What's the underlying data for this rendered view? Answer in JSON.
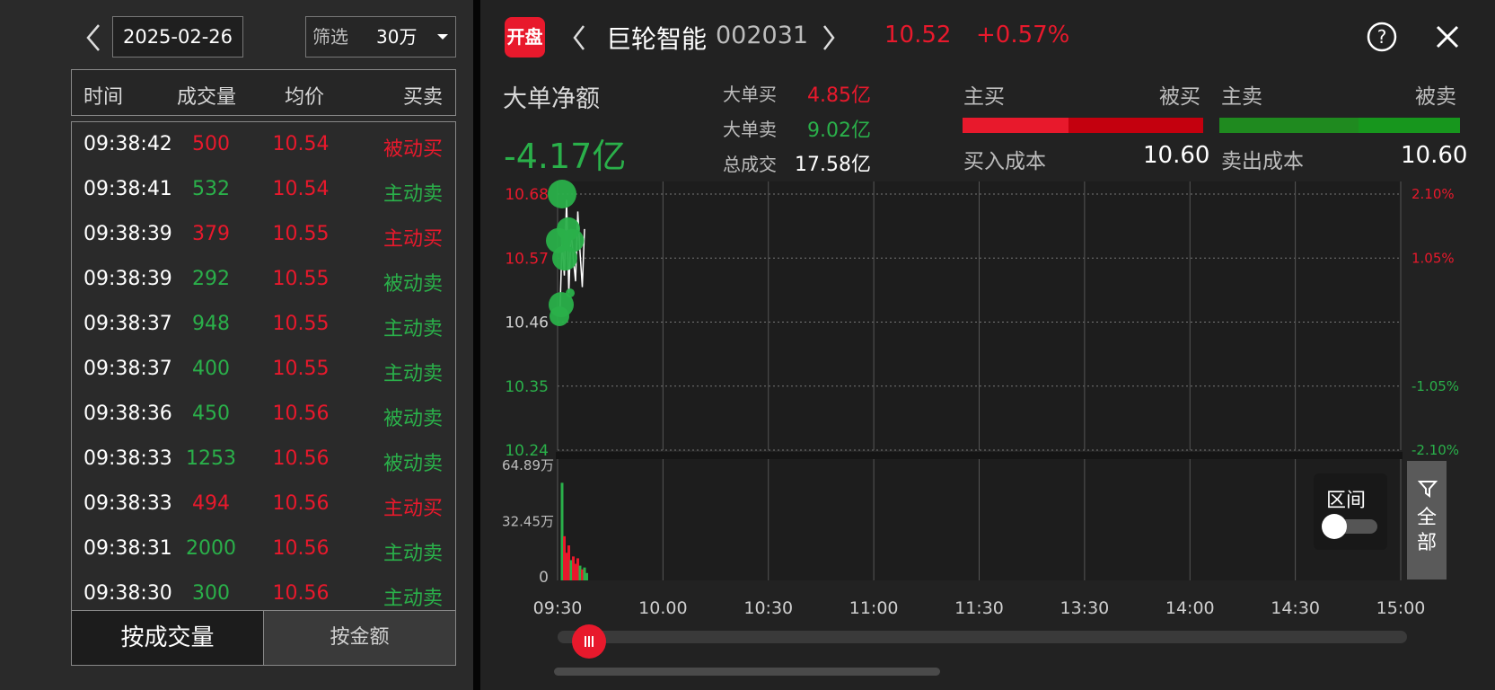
{
  "left": {
    "date": "2025-02-26",
    "filter_label": "筛选",
    "filter_value": "30万",
    "headers": [
      "时间",
      "成交量",
      "均价",
      "买卖"
    ],
    "rows": [
      {
        "time": "09:38:42",
        "vol": "500",
        "price": "10.54",
        "side": "被动买",
        "vol_color": "red",
        "side_color": "red"
      },
      {
        "time": "09:38:41",
        "vol": "532",
        "price": "10.54",
        "side": "主动卖",
        "vol_color": "green",
        "side_color": "green"
      },
      {
        "time": "09:38:39",
        "vol": "379",
        "price": "10.55",
        "side": "主动买",
        "vol_color": "red",
        "side_color": "red"
      },
      {
        "time": "09:38:39",
        "vol": "292",
        "price": "10.55",
        "side": "被动卖",
        "vol_color": "green",
        "side_color": "green"
      },
      {
        "time": "09:38:37",
        "vol": "948",
        "price": "10.55",
        "side": "主动卖",
        "vol_color": "green",
        "side_color": "green"
      },
      {
        "time": "09:38:37",
        "vol": "400",
        "price": "10.55",
        "side": "主动卖",
        "vol_color": "green",
        "side_color": "green"
      },
      {
        "time": "09:38:36",
        "vol": "450",
        "price": "10.56",
        "side": "被动卖",
        "vol_color": "green",
        "side_color": "green"
      },
      {
        "time": "09:38:33",
        "vol": "1253",
        "price": "10.56",
        "side": "被动卖",
        "vol_color": "green",
        "side_color": "green"
      },
      {
        "time": "09:38:33",
        "vol": "494",
        "price": "10.56",
        "side": "主动买",
        "vol_color": "red",
        "side_color": "red"
      },
      {
        "time": "09:38:31",
        "vol": "2000",
        "price": "10.56",
        "side": "主动卖",
        "vol_color": "green",
        "side_color": "green"
      },
      {
        "time": "09:38:30",
        "vol": "300",
        "price": "10.56",
        "side": "主动卖",
        "vol_color": "green",
        "side_color": "green"
      }
    ],
    "tab_volume": "按成交量",
    "tab_amount": "按金额"
  },
  "header": {
    "badge": "开盘",
    "name": "巨轮智能",
    "code": "002031",
    "price": "10.52",
    "change": "+0.57%"
  },
  "summary": {
    "net_label": "大单净额",
    "net_value": "-4.17亿",
    "big_buy_label": "大单买",
    "big_buy_value": "4.85亿",
    "big_sell_label": "大单卖",
    "big_sell_value": "9.02亿",
    "total_label": "总成交",
    "total_value": "17.58亿"
  },
  "flow": {
    "active_buy": "主买",
    "passive_buy": "被买",
    "active_sell": "主卖",
    "passive_sell": "被卖",
    "buy_cost_label": "买入成本",
    "buy_cost_value": "10.60",
    "sell_cost_label": "卖出成本",
    "sell_cost_value": "10.60",
    "active_buy_share": 0.44,
    "active_sell_share": 0.58
  },
  "colors": {
    "up": "#e8192c",
    "down": "#2ab04a"
  },
  "chart_data": [
    {
      "type": "scatter",
      "y_ticks_left": [
        "10.68",
        "10.57",
        "10.46",
        "10.35",
        "10.24"
      ],
      "y_ticks_right": [
        "2.10%",
        "1.05%",
        "",
        "-1.05%",
        "-2.10%"
      ],
      "ylim": [
        10.24,
        10.68
      ],
      "x_ticks": [
        "09:30",
        "10.00",
        "10:30",
        "11:00",
        "11:30",
        "13:30",
        "14:00",
        "14:30",
        "15:00"
      ],
      "price_line": [
        [
          0.5,
          10.47
        ],
        [
          1.0,
          10.6
        ],
        [
          1.5,
          10.54
        ],
        [
          2.0,
          10.67
        ],
        [
          2.5,
          10.51
        ],
        [
          3.0,
          10.62
        ],
        [
          3.5,
          10.57
        ],
        [
          4.0,
          10.53
        ],
        [
          4.5,
          10.65
        ],
        [
          5.0,
          10.58
        ],
        [
          5.5,
          10.52
        ],
        [
          6.0,
          10.62
        ]
      ],
      "bubbles": [
        {
          "t": 1.0,
          "price": 10.68,
          "size": 16,
          "color": "green"
        },
        {
          "t": 0.2,
          "price": 10.6,
          "size": 14,
          "color": "green"
        },
        {
          "t": 2.4,
          "price": 10.62,
          "size": 13,
          "color": "green"
        },
        {
          "t": 3.3,
          "price": 10.6,
          "size": 13,
          "color": "green"
        },
        {
          "t": 1.6,
          "price": 10.57,
          "size": 14,
          "color": "green"
        },
        {
          "t": 0.8,
          "price": 10.49,
          "size": 14,
          "color": "green"
        },
        {
          "t": 0.4,
          "price": 10.47,
          "size": 11,
          "color": "green"
        },
        {
          "t": 2.8,
          "price": 10.51,
          "size": 5,
          "color": "green"
        }
      ]
    },
    {
      "type": "bar",
      "y_ticks": [
        "64.89万",
        "32.45万",
        "0"
      ],
      "ymax": 64.89,
      "bars": [
        {
          "t": 0.3,
          "value": 53,
          "color": "green"
        },
        {
          "t": 0.8,
          "value": 24,
          "color": "red"
        },
        {
          "t": 1.3,
          "value": 15,
          "color": "red"
        },
        {
          "t": 1.8,
          "value": 19,
          "color": "red"
        },
        {
          "t": 2.3,
          "value": 11,
          "color": "green"
        },
        {
          "t": 2.8,
          "value": 13,
          "color": "red"
        },
        {
          "t": 3.3,
          "value": 9,
          "color": "red"
        },
        {
          "t": 3.8,
          "value": 12,
          "color": "red"
        },
        {
          "t": 4.3,
          "value": 8,
          "color": "green"
        },
        {
          "t": 4.8,
          "value": 6,
          "color": "red"
        },
        {
          "t": 5.3,
          "value": 7,
          "color": "green"
        },
        {
          "t": 5.8,
          "value": 4,
          "color": "green"
        }
      ]
    }
  ],
  "controls": {
    "range_label": "区间",
    "all_label": "全部"
  }
}
